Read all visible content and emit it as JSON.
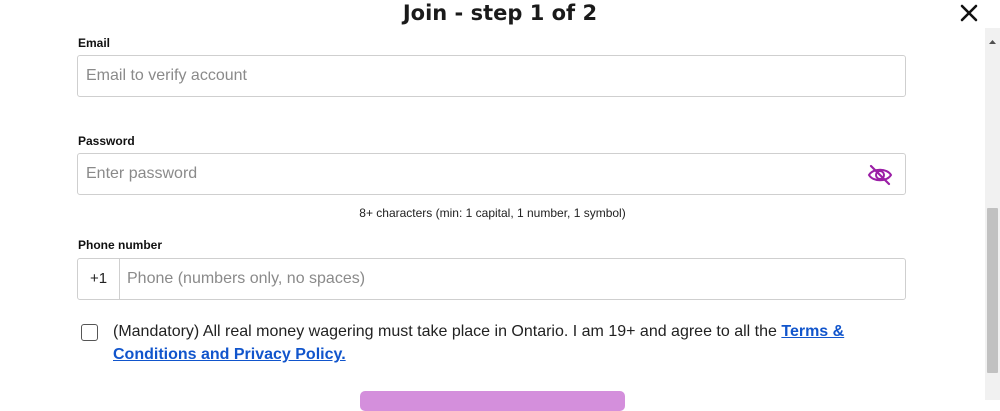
{
  "dialog": {
    "title": "Join - step 1 of 2"
  },
  "form": {
    "email": {
      "label": "Email",
      "placeholder": "Email to verify account",
      "value": ""
    },
    "password": {
      "label": "Password",
      "placeholder": "Enter password",
      "value": "",
      "hint": "8+ characters (min: 1 capital, 1 number, 1 symbol)"
    },
    "phone": {
      "label": "Phone number",
      "prefix": "+1",
      "placeholder": "Phone (numbers only, no spaces)",
      "value": ""
    },
    "consent": {
      "checked": false,
      "text": "(Mandatory) All real money wagering must take place in Ontario. I am 19+ and agree to all the ",
      "link_text": "Terms & Conditions and Privacy Policy."
    }
  },
  "colors": {
    "eye_icon": "#9b1fa6",
    "submit_button": "#d48fdc",
    "link": "#1155cc"
  },
  "icons": {
    "close": "close-icon",
    "password_toggle": "eye-off-icon",
    "scroll_up": "chevron-up-icon"
  }
}
